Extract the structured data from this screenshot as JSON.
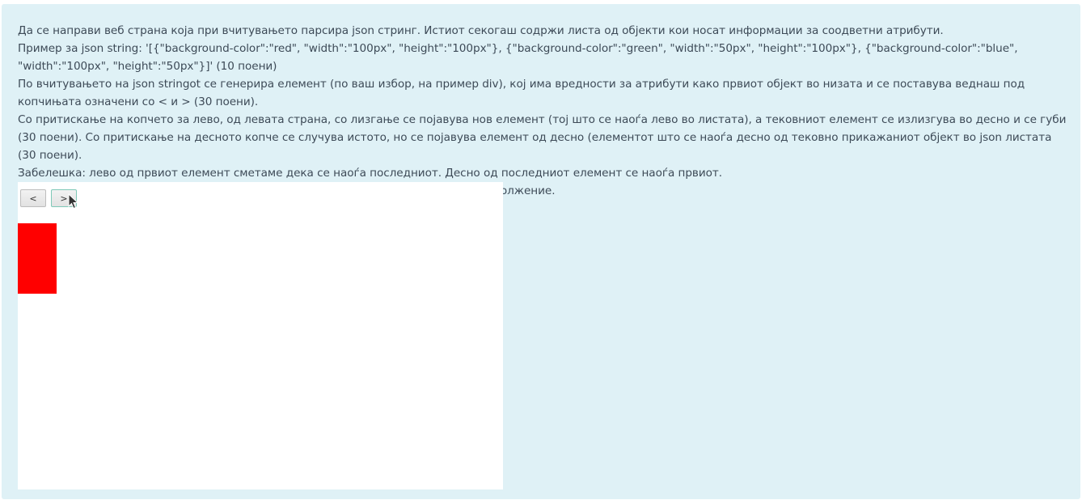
{
  "instructions": {
    "paragraphs": [
      "Да се направи веб страна која при вчитувањето парсира json стринг. Истиот секогаш содржи листа од објекти кои носат информации за соодветни атрибути.",
      "Пример за json string: '[{\"background-color\":\"red\", \"width\":\"100px\", \"height\":\"100px\"}, {\"background-color\":\"green\", \"width\":\"50px\", \"height\":\"100px\"}, {\"background-color\":\"blue\", \"width\":\"100px\", \"height\":\"50px\"}]' (10 поени)",
      "По вчитувањето на json stringot се генерира елемент (по ваш избор, на пример div), кој има вредности за атрибути како првиот објект во низата и се поставува веднаш под копчињата означени со < и > (30 поени).",
      "Со притискање на копчето за лево, од левата страна, со лизгање се појавува нов елемент (тој што се наоѓа лево во листата), а тековниот елемент се излизгува во десно и се губи (30 поени). Со притискање на десното копче се случува истото, но се појавува елемент од десно (елементот што се наоѓа десно од тековно прикажаниот објект во json листата (30 поени).",
      "Забелешка: лево од првиот елемент сметаме дека се наоѓа последниот. Десно од последниот елемент се наоѓа првиот.",
      "Како би требало да изледа целиот процес може да видите на gif-от даден во продолжение."
    ]
  },
  "demo": {
    "prev_label": "<",
    "next_label": ">",
    "current_element_color": "#ff0000"
  },
  "colors": {
    "panel_background": "#dff1f6",
    "text": "#3d4a57",
    "demo_background": "#ffffff"
  }
}
